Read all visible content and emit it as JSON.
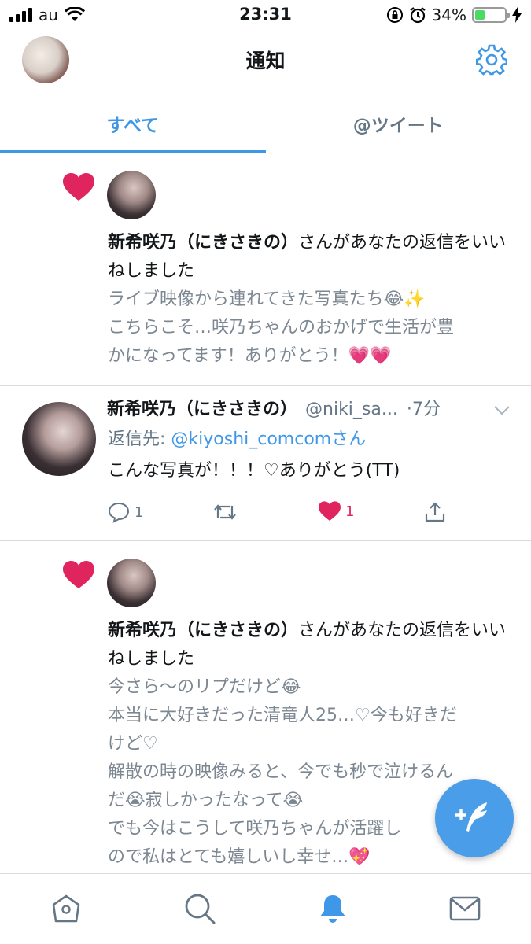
{
  "status_bar": {
    "carrier": "au",
    "time": "23:31",
    "battery_percent": "34%",
    "battery_level": 0.34
  },
  "header": {
    "title": "通知",
    "settings_icon": "gear-icon"
  },
  "tabs": [
    {
      "label": "すべて",
      "active": true
    },
    {
      "label": "@ツイート",
      "active": false
    }
  ],
  "feed": {
    "like_notification_1": {
      "name": "新希咲乃（にきさきの）",
      "action": "さんがあなたの返信をいいねしました",
      "quoted_lines": [
        "ライブ映像から連れてきた写真たち😂✨",
        "こちらこそ…咲乃ちゃんのおかげで生活が豊",
        "かになってます！ありがとう！💗💗"
      ]
    },
    "tweet": {
      "name": "新希咲乃（にきさきの）",
      "handle": "@niki_sa...",
      "time": "·7分",
      "reply_prefix": "返信先: ",
      "reply_target": "@kiyoshi_comcom",
      "reply_suffix": "さん",
      "body": "こんな写真が！！！♡ありがとう(TT)",
      "reply_count": "1",
      "like_count": "1"
    },
    "like_notification_2": {
      "name": "新希咲乃（にきさきの）",
      "action": "さんがあなたの返信をいいねしました",
      "quoted_lines": [
        "今さら〜のリプだけど😂",
        "本当に大好きだった清竜人25…♡今も好きだ",
        "けど♡",
        "解散の時の映像みると、今でも秒で泣けるん",
        "だ😭寂しかったなって😭",
        "でも今はこうして咲乃ちゃんが活躍し",
        "ので私はとても嬉しいし幸せ…💖"
      ]
    }
  },
  "bottom_nav": [
    {
      "icon": "home-icon",
      "active": false
    },
    {
      "icon": "search-icon",
      "active": false
    },
    {
      "icon": "bell-icon",
      "active": true
    },
    {
      "icon": "mail-icon",
      "active": false
    }
  ],
  "colors": {
    "accent": "#3f97e8",
    "like": "#e0245e",
    "muted": "#657786"
  }
}
